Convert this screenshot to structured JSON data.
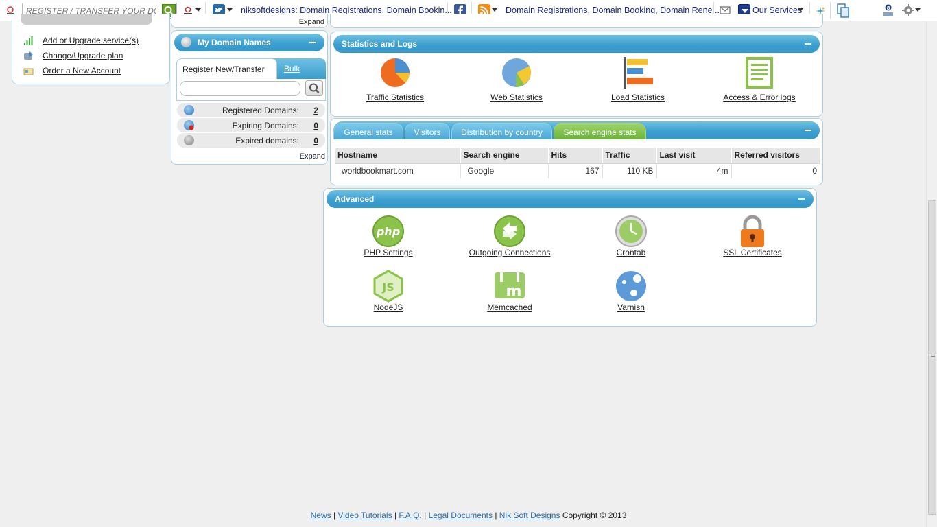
{
  "toolbar": {
    "search_placeholder": "REGISTER / TRANSFER YOUR DOMAIN",
    "site_title": "niksoftdesigns: Domain Registrations, Domain Bookin...",
    "feed_title": "Domain Registrations, Domain Booking, Domain Rene...",
    "our_services": "Our Services"
  },
  "left": {
    "items": [
      {
        "label": "Add or Upgrade service(s)",
        "icon": "signal-bars-icon"
      },
      {
        "label": "Change/Upgrade plan",
        "icon": "upgrade-plan-icon"
      },
      {
        "label": "Order a New Account",
        "icon": "new-account-icon"
      }
    ]
  },
  "domains": {
    "expand_top": "Expand",
    "title": "My Domain Names",
    "tab_register": "Register New/Transfer",
    "tab_bulk": "Bulk",
    "search_value": "",
    "rows": [
      {
        "label": "Registered Domains:",
        "count": "2"
      },
      {
        "label": "Expiring Domains:",
        "count": "0"
      },
      {
        "label": "Expired domains:",
        "count": "0"
      }
    ],
    "expand_bottom": "Expand"
  },
  "stats": {
    "title": "Statistics and Logs",
    "items": [
      {
        "label": "Traffic Statistics",
        "icon": "pie-chart-icon"
      },
      {
        "label": "Web Statistics",
        "icon": "pie-chart-blue-icon"
      },
      {
        "label": "Load Statistics",
        "icon": "bar-chart-icon"
      },
      {
        "label": "Access & Error logs",
        "icon": "log-document-icon"
      }
    ]
  },
  "tabs": {
    "items": [
      "General stats",
      "Visitors",
      "Distribution by country",
      "Search engine stats"
    ],
    "active": "Search engine stats",
    "table": {
      "headers": [
        "Hostname",
        "Search engine",
        "Hits",
        "Traffic",
        "Last visit",
        "Referred visitors"
      ],
      "rows": [
        [
          "worldbookmart.com",
          "Google",
          "167",
          "110 KB",
          "4m",
          "0"
        ]
      ]
    }
  },
  "advanced": {
    "title": "Advanced",
    "items": [
      {
        "label": "PHP Settings",
        "icon": "php-icon"
      },
      {
        "label": "Outgoing Connections",
        "icon": "outgoing-connections-icon"
      },
      {
        "label": "Crontab",
        "icon": "clock-icon"
      },
      {
        "label": "SSL Certificates",
        "icon": "padlock-icon"
      },
      {
        "label": "NodeJS",
        "icon": "nodejs-icon"
      },
      {
        "label": "Memcached",
        "icon": "memcached-icon"
      },
      {
        "label": "Varnish",
        "icon": "varnish-icon"
      }
    ]
  },
  "footer": {
    "links": [
      "News",
      "Video Tutorials",
      "F.A.Q.",
      "Legal Documents",
      "Nik Soft Designs"
    ],
    "separator": "|",
    "copyright": "Copyright © 2013"
  },
  "colors": {
    "bar_blue": "#3d9fcf",
    "tab_active_green": "#6ab33a",
    "link_blue": "#2a6fb0"
  }
}
